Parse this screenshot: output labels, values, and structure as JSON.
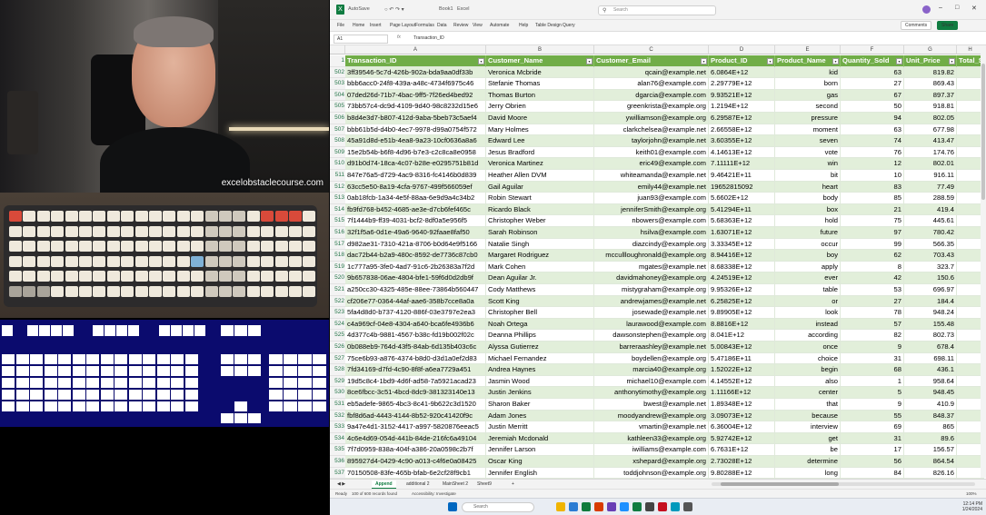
{
  "webcam": {
    "brand_text": "excelobstaclecourse.com"
  },
  "excel": {
    "title": {
      "autosave": "AutoSave",
      "file_name": "Book1",
      "app": "Excel"
    },
    "search_placeholder": "Search",
    "menu": [
      "File",
      "Home",
      "Insert",
      "Page Layout",
      "Formulas",
      "Data",
      "Review",
      "View",
      "Automate",
      "Help",
      "Table Design",
      "Query"
    ],
    "comments_label": "Comments",
    "share_label": "Share",
    "name_box": "A1",
    "formula_text": "Transaction_ID",
    "col_letters": [
      "A",
      "B",
      "C",
      "D",
      "E",
      "F",
      "G",
      "H"
    ],
    "headers": [
      "Transaction_ID",
      "Customer_Name",
      "Customer_Email",
      "Product_ID",
      "Product_Name",
      "Quantity_Sold",
      "Unit_Price",
      "Total_S"
    ],
    "rows": [
      [
        "502",
        "3ff39546-5c7d-426b-902a-bda9aa0df33b",
        "Veronica Mcbride",
        "qcain@example.net",
        "6.0864E+12",
        "kid",
        "63",
        "819.82"
      ],
      [
        "503",
        "bbb6acc0-24f8-439a-a48c-4734f6975c46",
        "Stefanie Thomas",
        "alan76@example.com",
        "2.29779E+12",
        "born",
        "27",
        "869.43"
      ],
      [
        "504",
        "07ded26d-71b7-4bac-9ff5-7f26ed4bed92",
        "Thomas Burton",
        "dgarcia@example.com",
        "9.93521E+12",
        "gas",
        "67",
        "897.37"
      ],
      [
        "505",
        "73bb57c4-dc9d-4109-9d40-98c8232d15e6",
        "Jerry Obrien",
        "greenkrista@example.org",
        "1.2194E+12",
        "second",
        "50",
        "918.81"
      ],
      [
        "506",
        "b8d4e3d7-b807-412d-9aba-5beb73c5aef4",
        "David Moore",
        "ywilliamson@example.org",
        "6.29587E+12",
        "pressure",
        "94",
        "802.05"
      ],
      [
        "507",
        "bbb61b5d-d4b0-4ec7-9978-d99a0754f572",
        "Mary Holmes",
        "clarkchelsea@example.net",
        "2.66558E+12",
        "moment",
        "63",
        "677.98"
      ],
      [
        "508",
        "45a91d8d-e51b-4ea8-9a23-10cf0636a8a6",
        "Edward Lee",
        "taylorjohn@example.net",
        "3.60355E+12",
        "seven",
        "74",
        "413.47"
      ],
      [
        "509",
        "15e2b54b-b6f8-4d96-b7e3-c2c8ca8e0958",
        "Jesus Bradford",
        "keith01@example.com",
        "4.14613E+12",
        "vote",
        "76",
        "174.76"
      ],
      [
        "510",
        "d91b0d74-18ca-4c07-b28e-e0295751b81d",
        "Veronica Martinez",
        "eric49@example.com",
        "7.11111E+12",
        "win",
        "12",
        "802.01"
      ],
      [
        "511",
        "847e76a5-d729-4ac9-8316-fc4146b0d839",
        "Heather Allen DVM",
        "whiteamanda@example.net",
        "9.46421E+11",
        "bit",
        "10",
        "916.11"
      ],
      [
        "512",
        "63cc5e50-8a19-4cfa-9767-499f566059ef",
        "Gail Aguilar",
        "emily44@example.net",
        "19652815092",
        "heart",
        "83",
        "77.49"
      ],
      [
        "513",
        "0ab18fcb-1a34-4e5f-88aa-6e9d9a4c34b2",
        "Robin Stewart",
        "juan93@example.com",
        "5.6602E+12",
        "body",
        "85",
        "288.59"
      ],
      [
        "514",
        "fb9fd768-b452-4685-ae3e-d7cb6fef465c",
        "Ricardo Black",
        "jenniferSmith@example.org",
        "5.41294E+11",
        "box",
        "21",
        "419.4"
      ],
      [
        "515",
        "7f1444b9-ff39-4031-bcf2-8df0a5e956f5",
        "Christopher Weber",
        "nbowers@example.com",
        "5.68363E+12",
        "hold",
        "75",
        "445.61"
      ],
      [
        "516",
        "32f1f5a6-0d1e-49a6-9640-92faae8faf50",
        "Sarah Robinson",
        "hsilva@example.com",
        "1.63071E+12",
        "future",
        "97",
        "780.42"
      ],
      [
        "517",
        "d982ae31-7310-421a-8706-b0d64e9f5166",
        "Natalie Singh",
        "diazcindy@example.org",
        "3.33345E+12",
        "occur",
        "99",
        "566.35"
      ],
      [
        "518",
        "dac72b44-b2a9-480c-8592-de7736c87cb0",
        "Margaret Rodriguez",
        "mccullloughronald@example.org",
        "8.94416E+12",
        "boy",
        "62",
        "703.43"
      ],
      [
        "519",
        "1c777a95-3fe0-4ad7-91c6-2b26383a7f2d",
        "Mark Cohen",
        "mgates@example.net",
        "8.68338E+12",
        "apply",
        "8",
        "323.7"
      ],
      [
        "520",
        "9b657838-06ae-4804-bfe1-59f6d0d2db9f",
        "Dean Aguilar Jr.",
        "davidmahoney@example.org",
        "4.24519E+12",
        "ever",
        "42",
        "150.6"
      ],
      [
        "521",
        "a250cc30-4325-485e-88ee-73864b560447",
        "Cody Matthews",
        "mistygraham@example.org",
        "9.95326E+12",
        "table",
        "53",
        "696.97"
      ],
      [
        "522",
        "cf206e77-0364-44af-aae6-358b7cce8a0a",
        "Scott King",
        "andrewjames@example.net",
        "6.25825E+12",
        "or",
        "27",
        "184.4"
      ],
      [
        "523",
        "5fa4d8d0-b737-4120-886f-03e3797e2ea3",
        "Christopher Bell",
        "josewade@example.net",
        "9.89905E+12",
        "look",
        "78",
        "948.24"
      ],
      [
        "524",
        "c4a969cf-04e8-4304-a640-bca6fe4936b6",
        "Noah Ortega",
        "laurawood@example.com",
        "8.8816E+12",
        "instead",
        "57",
        "155.48"
      ],
      [
        "525",
        "4d377c4b-9881-4567-b38c-fd19b002f02c",
        "Deanna Phillips",
        "dawsonstephen@example.org",
        "8.041E+12",
        "according",
        "82",
        "802.73"
      ],
      [
        "526",
        "0b088eb9-764d-43f5-84ab-6d135b403c6c",
        "Alyssa Gutierrez",
        "barreraashley@example.net",
        "5.00843E+12",
        "once",
        "9",
        "678.4"
      ],
      [
        "527",
        "75ce6b93-a876-4374-b8d0-d3d1a0ef2d83",
        "Michael Fernandez",
        "boydellen@example.org",
        "5.47186E+11",
        "choice",
        "31",
        "698.11"
      ],
      [
        "528",
        "7fd34169-d7fd-4c90-8f8f-a6ea7729a451",
        "Andrea Haynes",
        "marcia40@example.org",
        "1.52022E+12",
        "begin",
        "68",
        "436.1"
      ],
      [
        "529",
        "19d5c8c4-1bd9-4d6f-ad58-7a5921acad23",
        "Jasmin Wood",
        "michael10@example.com",
        "4.14552E+12",
        "also",
        "1",
        "958.64"
      ],
      [
        "530",
        "8ce6fbcc-3c51-4bcd-8dc9-381323140e13",
        "Justin Jenkins",
        "anthonytimothy@example.org",
        "1.11166E+12",
        "center",
        "5",
        "948.45"
      ],
      [
        "531",
        "eb5adefe-9865-4bc3-8c41-9b622c3d1520",
        "Sharon Baker",
        "bwest@example.net",
        "1.89348E+12",
        "that",
        "9",
        "410.9"
      ],
      [
        "532",
        "fbf8d6ad-4443-4144-8b52-920c41420f9c",
        "Adam Jones",
        "moodyandrew@example.org",
        "3.09073E+12",
        "because",
        "55",
        "848.37"
      ],
      [
        "533",
        "9a47e4d1-3152-4417-a997-5820876eeac5",
        "Justin Merritt",
        "vmartin@example.net",
        "6.36004E+12",
        "interview",
        "69",
        "865"
      ],
      [
        "534",
        "4c6e4d69-054d-441b-84de-216fc6a49104",
        "Jeremiah Mcdonald",
        "kathleen33@example.org",
        "5.92742E+12",
        "get",
        "31",
        "89.6"
      ],
      [
        "535",
        "7f7d0959-838a-404f-a386-20a0598c2b7f",
        "Jennifer Larson",
        "iwilliams@example.com",
        "6.7631E+12",
        "be",
        "17",
        "156.57"
      ],
      [
        "536",
        "895927d4-0429-4c90-a013-c4f6e0a08425",
        "Oscar King",
        "xshepard@example.org",
        "2.73028E+12",
        "determine",
        "56",
        "864.54"
      ],
      [
        "537",
        "70150508-83fe-465b-bfab-6e2cf28f9cb1",
        "Jennifer English",
        "toddjohnson@example.org",
        "9.80288E+12",
        "long",
        "84",
        "826.16"
      ]
    ],
    "sheet_tabs": [
      "Append",
      "additional 2",
      "MainSheet 2",
      "Sheet9"
    ],
    "status": {
      "ready": "Ready",
      "records": "100 of 600 records found",
      "accessibility": "Accessibility: Investigate",
      "zoom": "100%"
    },
    "taskbar": {
      "search": "Search",
      "time": "12:14 PM",
      "date": "1/24/2024"
    }
  }
}
